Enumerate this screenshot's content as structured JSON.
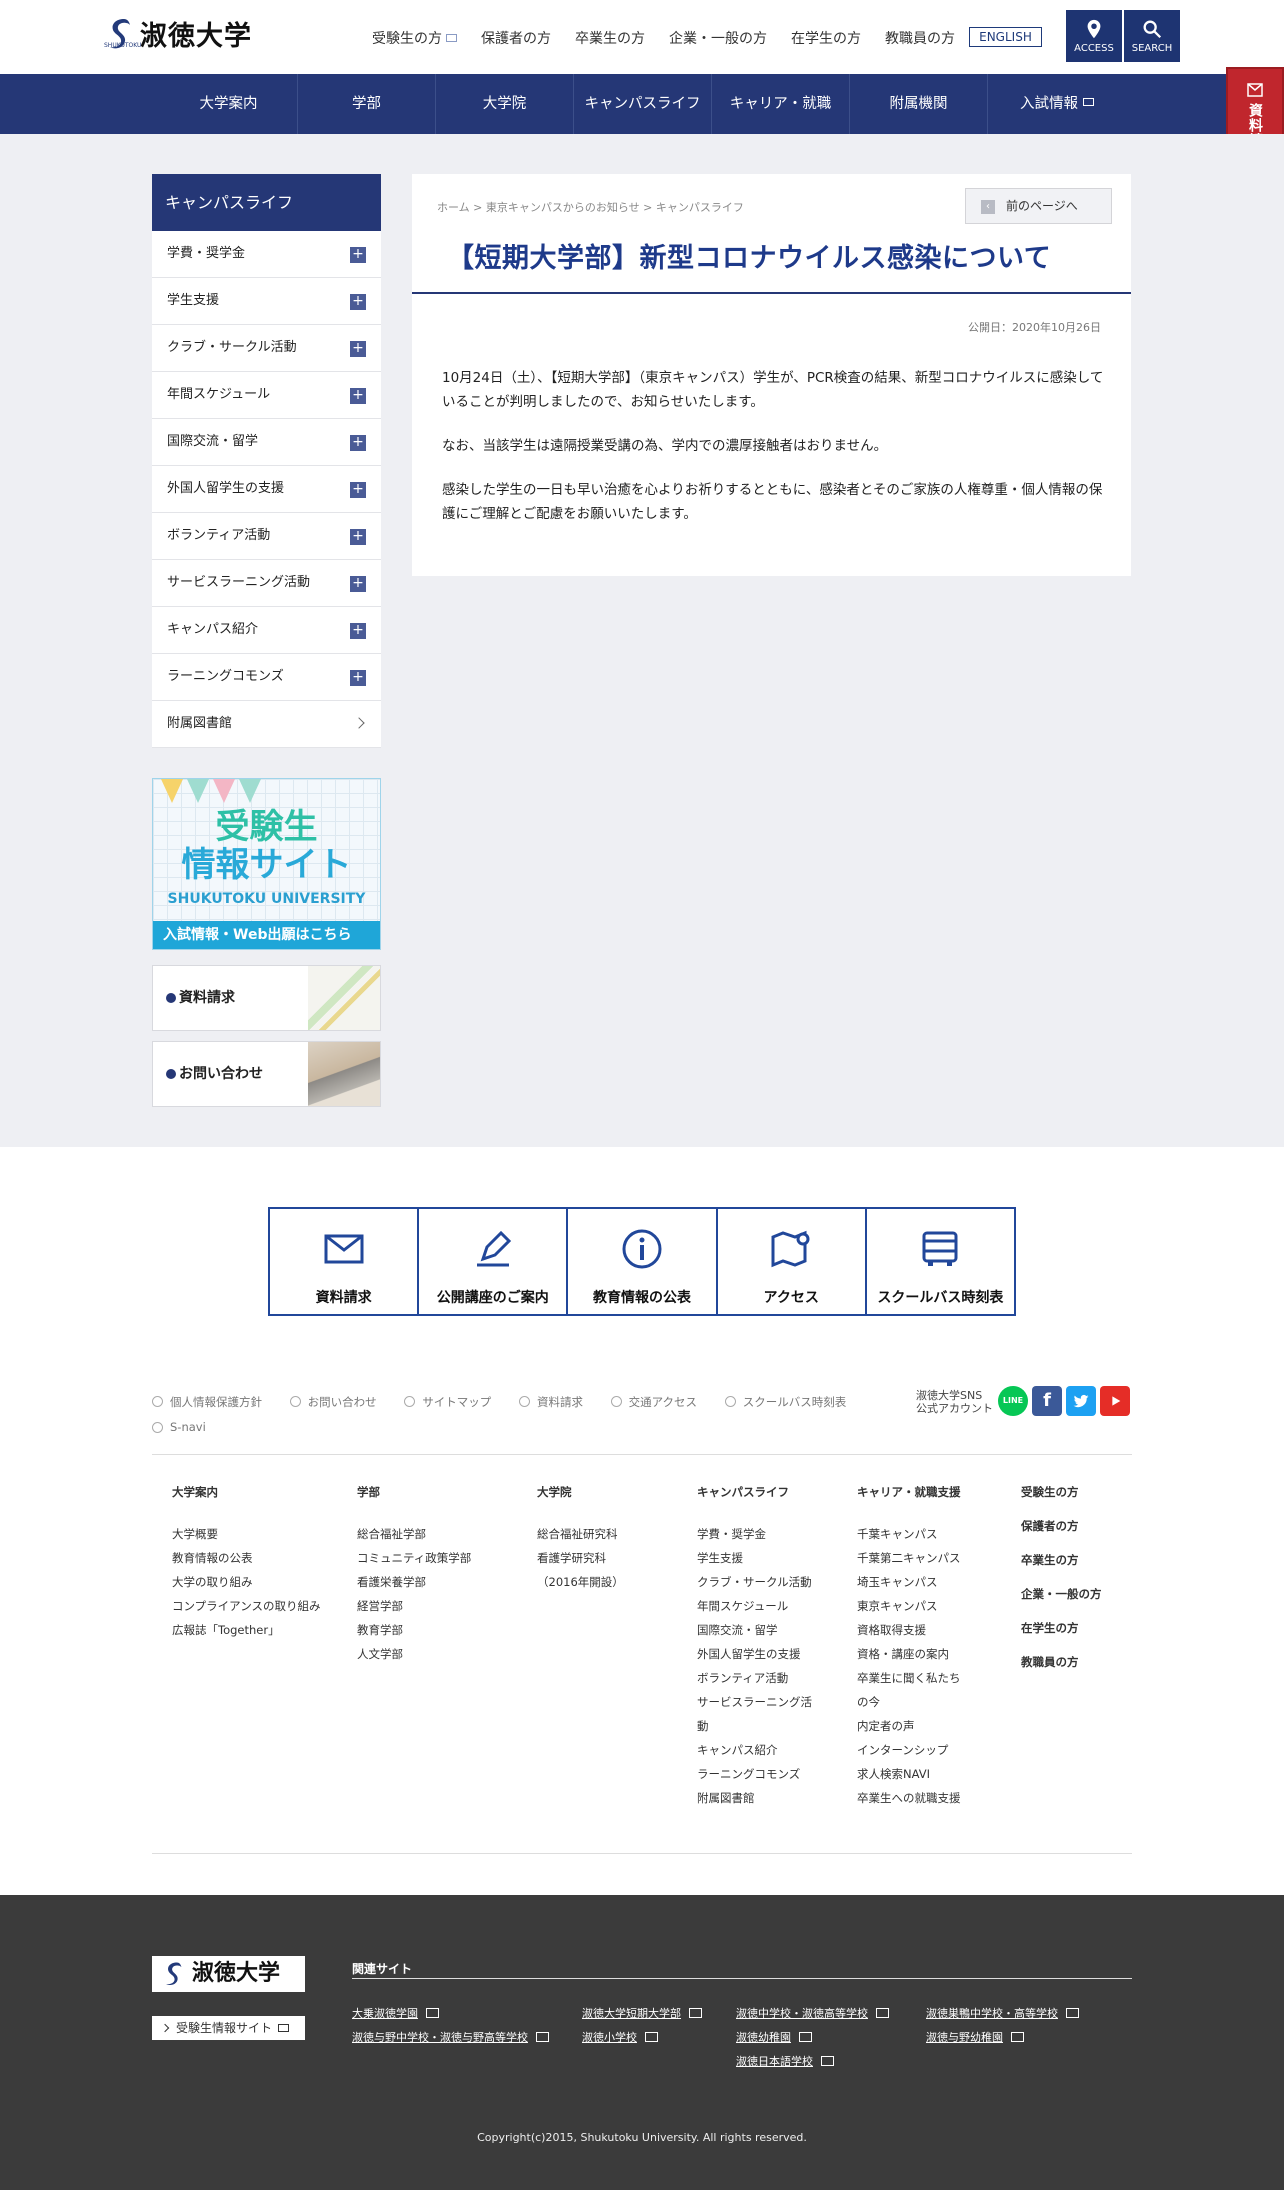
{
  "header": {
    "logo_text": "淑徳大学",
    "logo_sub": "SHUKUTOKU",
    "top_nav": [
      "受験生の方",
      "保護者の方",
      "卒業生の方",
      "企業・一般の方",
      "在学生の方",
      "教職員の方"
    ],
    "english_label": "ENGLISH",
    "access_label": "ACCESS",
    "search_label": "SEARCH"
  },
  "main_nav": [
    "大学案内",
    "学部",
    "大学院",
    "キャンパスライフ",
    "キャリア・就職",
    "附属機関",
    "入試情報"
  ],
  "side_tab": {
    "label": "資料請求"
  },
  "sidebar": {
    "title": "キャンパスライフ",
    "items": [
      {
        "label": "学費・奨学金"
      },
      {
        "label": "学生支援"
      },
      {
        "label": "クラブ・サークル活動"
      },
      {
        "label": "年間スケジュール"
      },
      {
        "label": "国際交流・留学"
      },
      {
        "label": "外国人留学生の支援"
      },
      {
        "label": "ボランティア活動"
      },
      {
        "label": "サービスラーニング活動"
      },
      {
        "label": "キャンパス紹介"
      },
      {
        "label": "ラーニングコモンズ"
      },
      {
        "label": "附属図書館"
      }
    ],
    "banner": {
      "line1": "受験生",
      "line2": "情報サイト",
      "line3": "SHUKUTOKU UNIVERSITY",
      "footer": "入試情報・Web出願はこちら"
    },
    "box1": "資料請求",
    "box2": "お問い合わせ"
  },
  "content": {
    "breadcrumb": [
      "ホーム",
      "東京キャンパスからのお知らせ",
      "キャンパスライフ"
    ],
    "prev_label": "前のページへ",
    "title": "【短期大学部】新型コロナウイルス感染について",
    "published": "公開日：2020年10月26日",
    "paragraphs": [
      "10月24日（土）、【短期大学部】（東京キャンパス）学生が、PCR検査の結果、新型コロナウイルスに感染していることが判明しましたので、お知らせいたします。",
      "なお、当該学生は遠隔授業受講の為、学内での濃厚接触者はおりません。",
      "感染した学生の一日も早い治癒を心よりお祈りするとともに、感染者とそのご家族の人権尊重・個人情報の保護にご理解とご配慮をお願いいたします。"
    ]
  },
  "icon_boxes": [
    "資料請求",
    "公開講座のご案内",
    "教育情報の公表",
    "アクセス",
    "スクールバス時刻表"
  ],
  "footer_links": [
    "個人情報保護方針",
    "お問い合わせ",
    "サイトマップ",
    "資料請求",
    "交通アクセス",
    "スクールバス時刻表"
  ],
  "footer_links2": "S-navi",
  "sns": {
    "label1": "淑徳大学SNS",
    "label2": "公式アカウント",
    "line": "LINE"
  },
  "footer_cols": [
    {
      "title": "大学案内",
      "items": [
        "大学概要",
        "教育情報の公表",
        "大学の取り組み",
        "コンプライアンスの取り組み",
        "広報誌「Together」"
      ]
    },
    {
      "title": "学部",
      "items": [
        "総合福祉学部",
        "コミュニティ政策学部",
        "看護栄養学部",
        "経営学部",
        "教育学部",
        "人文学部"
      ]
    },
    {
      "title": "大学院",
      "items": [
        "総合福祉研究科",
        "看護学研究科",
        "（2016年開設）"
      ]
    },
    {
      "title": "キャンパスライフ",
      "items": [
        "学費・奨学金",
        "学生支援",
        "クラブ・サークル活動",
        "年間スケジュール",
        "国際交流・留学",
        "外国人留学生の支援",
        "ボランティア活動",
        "サービスラーニング活",
        "動",
        "キャンパス紹介",
        "ラーニングコモンズ",
        "附属図書館"
      ]
    },
    {
      "title": "キャリア・就職支援",
      "items": [
        "千葉キャンパス",
        "千葉第二キャンパス",
        "埼玉キャンパス",
        "東京キャンパス",
        "資格取得支援",
        "資格・講座の案内",
        "卒業生に聞く私たち",
        "の今",
        "内定者の声",
        "インターンシップ",
        "求人検索NAVI",
        "卒業生への就職支援"
      ]
    }
  ],
  "footer_col6": [
    "受験生の方",
    "保護者の方",
    "卒業生の方",
    "企業・一般の方",
    "在学生の方",
    "教職員の方"
  ],
  "dark_footer": {
    "logo": "淑徳大学",
    "juken": "受験生情報サイト",
    "related_title": "関連サイト",
    "related": [
      "大乗淑徳学園",
      "淑徳大学短期大学部",
      "淑徳中学校・淑徳高等学校",
      "淑徳巣鴨中学校・高等学校",
      "淑徳与野中学校・淑徳与野高等学校",
      "淑徳小学校",
      "淑徳幼稚園",
      "淑徳与野幼稚園",
      "淑徳日本語学校"
    ],
    "copyright": "Copyright(c)2015, Shukutoku University. All rights reserved."
  },
  "colors": {
    "navy": "#253776",
    "red": "#c0262d",
    "line": "#06c755",
    "facebook": "#3b5998",
    "twitter": "#1da1f2",
    "youtube": "#e52d27"
  }
}
